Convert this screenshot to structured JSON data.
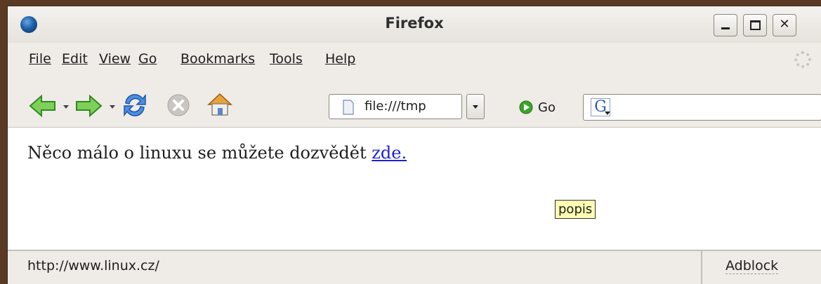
{
  "window": {
    "title": "Firefox"
  },
  "menu": [
    "File",
    "Edit",
    "View",
    "Go",
    "Bookmarks",
    "Tools",
    "Help"
  ],
  "toolbar": {
    "back_icon": "back-arrow-icon",
    "forward_icon": "forward-arrow-icon",
    "reload_icon": "reload-icon",
    "stop_icon": "stop-icon",
    "home_icon": "home-icon",
    "url_value": "file:///tmp",
    "go_label": "Go",
    "search_value": ""
  },
  "page": {
    "text": "Něco málo o linuxu se můžete dozvědět ",
    "link_text": "zde.",
    "tooltip": "popis"
  },
  "status": {
    "text": "http://www.linux.cz/",
    "adblock": "Adblock"
  },
  "colors": {
    "accent_green": "#3aa52a",
    "link": "#1f1fd2",
    "tooltip_bg": "#ffffb4"
  }
}
